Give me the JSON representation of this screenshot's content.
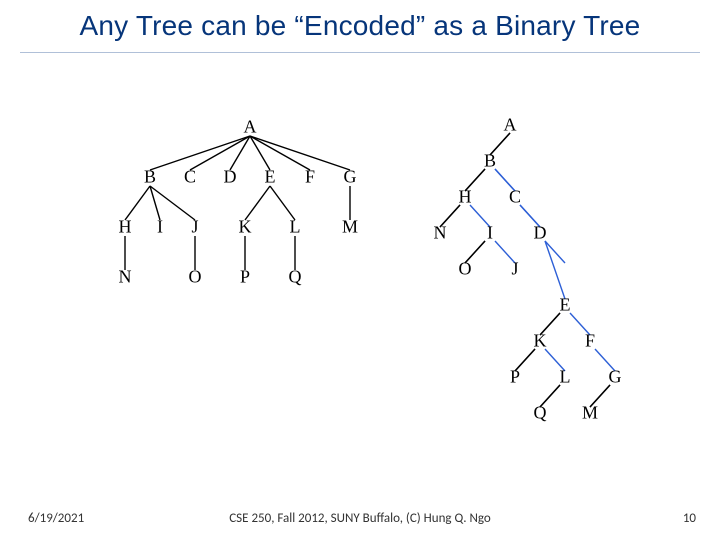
{
  "title": "Any Tree can be “Encoded” as a Binary Tree",
  "footer": {
    "date": "6/19/2021",
    "center": "CSE 250, Fall 2012, SUNY Buffalo, (C) Hung Q. Ngo",
    "page": "10"
  },
  "left_tree": {
    "nodes": [
      "A",
      "B",
      "C",
      "D",
      "E",
      "F",
      "G",
      "H",
      "I",
      "J",
      "K",
      "L",
      "M",
      "N",
      "O",
      "P",
      "Q"
    ],
    "edges_parent_child": [
      [
        "A",
        "B"
      ],
      [
        "A",
        "C"
      ],
      [
        "A",
        "D"
      ],
      [
        "A",
        "E"
      ],
      [
        "A",
        "F"
      ],
      [
        "A",
        "G"
      ],
      [
        "B",
        "H"
      ],
      [
        "B",
        "I"
      ],
      [
        "B",
        "J"
      ],
      [
        "E",
        "K"
      ],
      [
        "E",
        "L"
      ],
      [
        "G",
        "M"
      ],
      [
        "H",
        "N"
      ],
      [
        "J",
        "O"
      ],
      [
        "K",
        "P"
      ],
      [
        "L",
        "Q"
      ]
    ]
  },
  "right_tree": {
    "nodes": [
      "A",
      "B",
      "H",
      "C",
      "N",
      "I",
      "D",
      "O",
      "J",
      "E",
      "K",
      "F",
      "P",
      "L",
      "G",
      "Q",
      "M"
    ],
    "black_left_child_edges": [
      [
        "A",
        "B"
      ],
      [
        "B",
        "H"
      ],
      [
        "H",
        "N"
      ],
      [
        "I",
        "O"
      ],
      [
        "E",
        "K"
      ],
      [
        "K",
        "P"
      ],
      [
        "L",
        "Q"
      ],
      [
        "G",
        "M"
      ]
    ],
    "blue_right_sibling_edges": [
      [
        "B",
        "C"
      ],
      [
        "C",
        "D"
      ],
      [
        "D",
        "E"
      ],
      [
        "E",
        "F"
      ],
      [
        "F",
        "G"
      ],
      [
        "H",
        "I"
      ],
      [
        "I",
        "J"
      ],
      [
        "K",
        "L"
      ]
    ]
  }
}
